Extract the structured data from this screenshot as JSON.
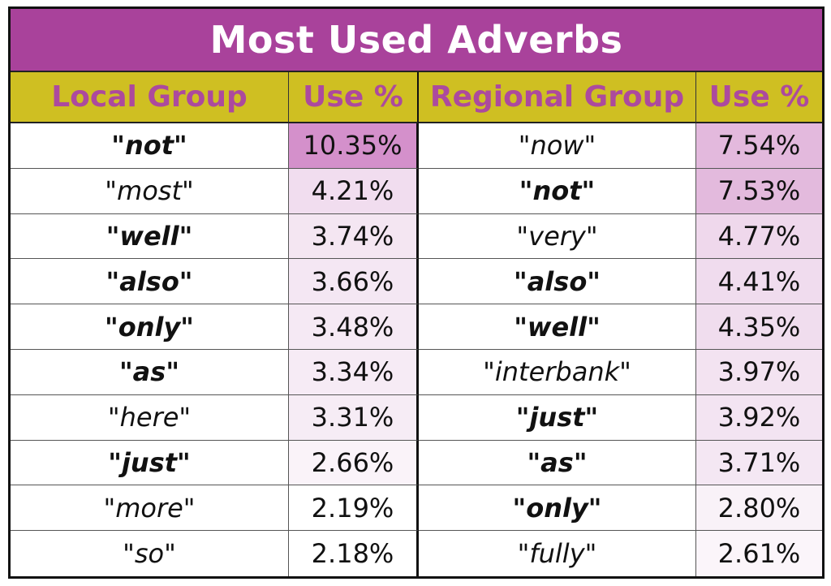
{
  "title": "Most Used Adverbs",
  "headers": [
    "Local Group",
    "Use %",
    "Regional Group",
    "Use %"
  ],
  "colors": {
    "title_bg": "#A9429B",
    "header_bg": "#CFBF22",
    "header_text": "#AC4A9E",
    "title_text": "#FFFFFF"
  },
  "rows": [
    {
      "local": {
        "word": "\"not\"",
        "bold": true,
        "pct": "10.35%",
        "shade": "#D490CB"
      },
      "regional": {
        "word": "\"now\"",
        "bold": false,
        "pct": "7.54%",
        "shade": "#E3B9DD"
      }
    },
    {
      "local": {
        "word": "\"most\"",
        "bold": false,
        "pct": "4.21%",
        "shade": "#F1DDEF"
      },
      "regional": {
        "word": "\"not\"",
        "bold": true,
        "pct": "7.53%",
        "shade": "#E3BADD"
      }
    },
    {
      "local": {
        "word": "\"well\"",
        "bold": true,
        "pct": "3.74%",
        "shade": "#F4E6F2"
      },
      "regional": {
        "word": "\"very\"",
        "bold": false,
        "pct": "4.77%",
        "shade": "#EFD8EC"
      }
    },
    {
      "local": {
        "word": "\"also\"",
        "bold": true,
        "pct": "3.66%",
        "shade": "#F4E7F3"
      },
      "regional": {
        "word": "\"also\"",
        "bold": true,
        "pct": "4.41%",
        "shade": "#F0DCEE"
      }
    },
    {
      "local": {
        "word": "\"only\"",
        "bold": true,
        "pct": "3.48%",
        "shade": "#F5E9F4"
      },
      "regional": {
        "word": "\"well\"",
        "bold": true,
        "pct": "4.35%",
        "shade": "#F0DDEE"
      }
    },
    {
      "local": {
        "word": "\"as\"",
        "bold": true,
        "pct": "3.34%",
        "shade": "#F6EBF5"
      },
      "regional": {
        "word": "\"interbank\"",
        "bold": false,
        "pct": "3.97%",
        "shade": "#F3E3F1"
      }
    },
    {
      "local": {
        "word": "\"here\"",
        "bold": false,
        "pct": "3.31%",
        "shade": "#F6ECF5"
      },
      "regional": {
        "word": "\"just\"",
        "bold": true,
        "pct": "3.92%",
        "shade": "#F3E4F2"
      }
    },
    {
      "local": {
        "word": "\"just\"",
        "bold": true,
        "pct": "2.66%",
        "shade": "#FAF3F9"
      },
      "regional": {
        "word": "\"as\"",
        "bold": true,
        "pct": "3.71%",
        "shade": "#F4E7F3"
      }
    },
    {
      "local": {
        "word": "\"more\"",
        "bold": false,
        "pct": "2.19%",
        "shade": "#FFFFFF"
      },
      "regional": {
        "word": "\"only\"",
        "bold": true,
        "pct": "2.80%",
        "shade": "#F9F2F8"
      }
    },
    {
      "local": {
        "word": "\"so\"",
        "bold": false,
        "pct": "2.18%",
        "shade": "#FFFFFF"
      },
      "regional": {
        "word": "\"fully\"",
        "bold": false,
        "pct": "2.61%",
        "shade": "#FBF5FA"
      }
    }
  ]
}
